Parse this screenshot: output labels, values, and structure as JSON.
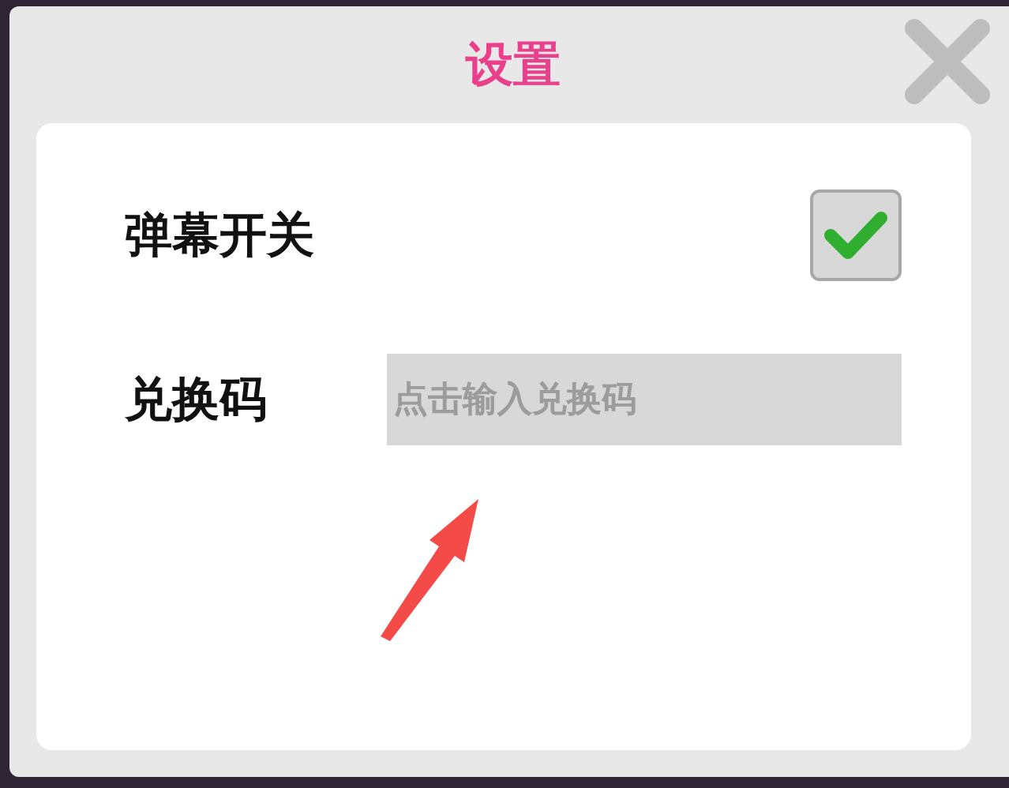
{
  "dialog": {
    "title": "设置"
  },
  "rows": [
    {
      "kind": "toggle",
      "label": "弹幕开关",
      "checked": true
    },
    {
      "kind": "input",
      "label": "兑换码",
      "placeholder": "点击输入兑换码"
    }
  ],
  "annotation": {
    "kind": "arrow"
  }
}
